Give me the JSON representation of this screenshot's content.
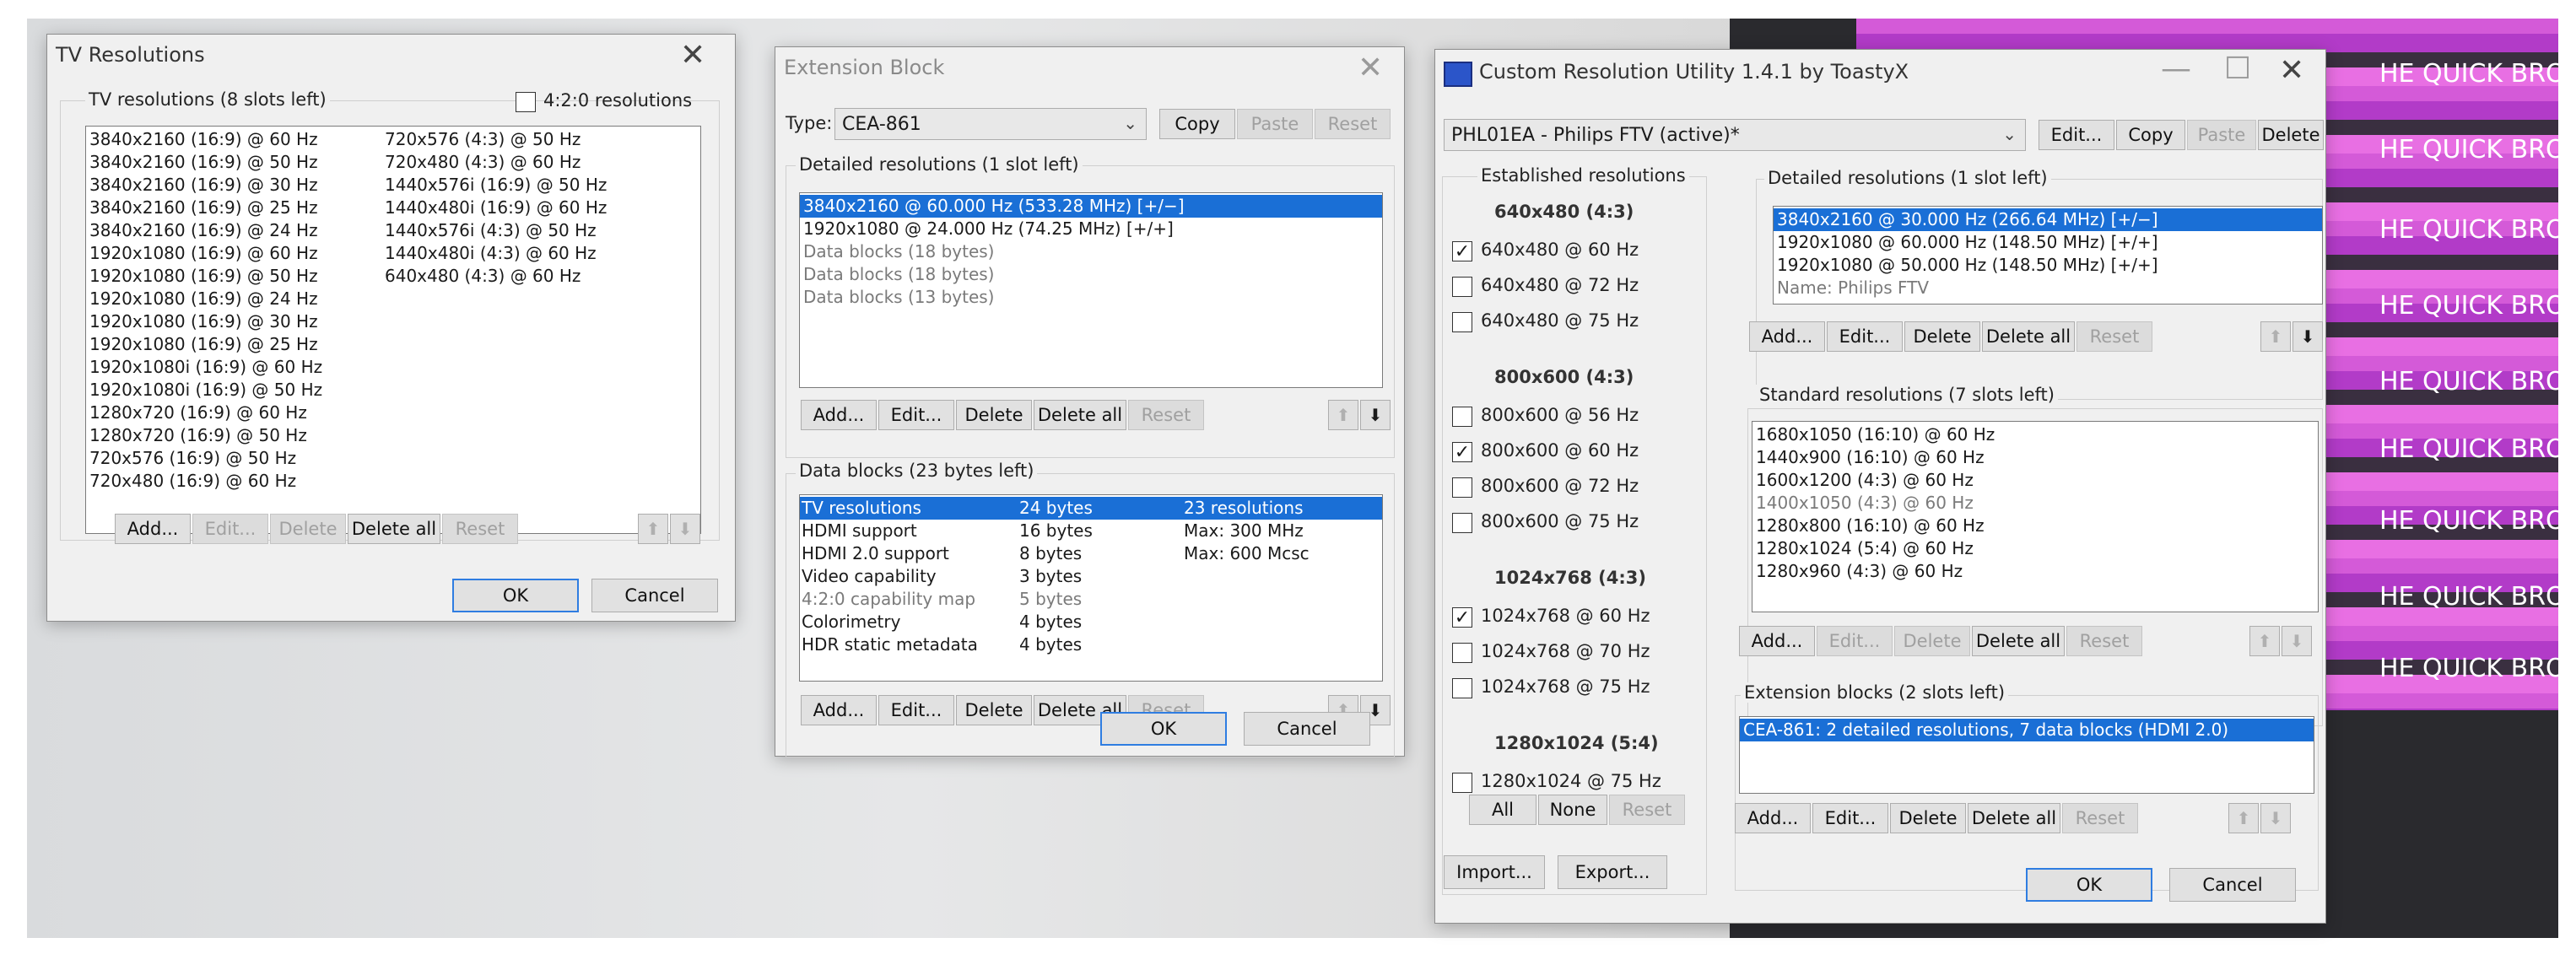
{
  "tv_dialog": {
    "title": "TV Resolutions",
    "group_label": "TV resolutions (8 slots left)",
    "option_420": "4:2:0 resolutions",
    "col1": [
      "3840x2160 (16:9) @ 60 Hz",
      "3840x2160 (16:9) @ 50 Hz",
      "3840x2160 (16:9) @ 30 Hz",
      "3840x2160 (16:9) @ 25 Hz",
      "3840x2160 (16:9) @ 24 Hz",
      "1920x1080 (16:9) @ 60 Hz",
      "1920x1080 (16:9) @ 50 Hz",
      "1920x1080 (16:9) @ 24 Hz",
      "1920x1080 (16:9) @ 30 Hz",
      "1920x1080 (16:9) @ 25 Hz",
      "1920x1080i (16:9) @ 60 Hz",
      "1920x1080i (16:9) @ 50 Hz",
      "1280x720 (16:9) @ 60 Hz",
      "1280x720 (16:9) @ 50 Hz",
      "720x576 (16:9) @ 50 Hz",
      "720x480 (16:9) @ 60 Hz"
    ],
    "col2": [
      "720x576 (4:3) @ 50 Hz",
      "720x480 (4:3) @ 60 Hz",
      "1440x576i (16:9) @ 50 Hz",
      "1440x480i (16:9) @ 60 Hz",
      "1440x576i (4:3) @ 50 Hz",
      "1440x480i (4:3) @ 60 Hz",
      "640x480 (4:3) @ 60 Hz"
    ],
    "buttons": {
      "add": "Add...",
      "edit": "Edit...",
      "delete": "Delete",
      "delete_all": "Delete all",
      "reset": "Reset",
      "ok": "OK",
      "cancel": "Cancel"
    }
  },
  "ext_dialog": {
    "title": "Extension Block",
    "type_label": "Type:",
    "type_value": "CEA-861",
    "copy": "Copy",
    "paste": "Paste",
    "reset": "Reset",
    "detailed_label": "Detailed resolutions (1 slot left)",
    "detailed": [
      "3840x2160 @ 60.000 Hz (533.28 MHz) [+/−]",
      "1920x1080 @ 24.000 Hz (74.25 MHz) [+/+]",
      "Data blocks (18 bytes)",
      "Data blocks (18 bytes)",
      "Data blocks (13 bytes)"
    ],
    "datablocks_label": "Data blocks (23 bytes left)",
    "datablocks": [
      {
        "name": "TV resolutions",
        "size": "24 bytes",
        "info": "23 resolutions"
      },
      {
        "name": "HDMI support",
        "size": "16 bytes",
        "info": "Max: 300 MHz"
      },
      {
        "name": "HDMI 2.0 support",
        "size": "8 bytes",
        "info": "Max: 600 Mcsc"
      },
      {
        "name": "Video capability",
        "size": "3 bytes",
        "info": ""
      },
      {
        "name": "4:2:0 capability map",
        "size": "5 bytes",
        "info": ""
      },
      {
        "name": "Colorimetry",
        "size": "4 bytes",
        "info": ""
      },
      {
        "name": "HDR static metadata",
        "size": "4 bytes",
        "info": ""
      }
    ],
    "buttons": {
      "add": "Add...",
      "edit": "Edit...",
      "delete": "Delete",
      "delete_all": "Delete all",
      "reset": "Reset",
      "ok": "OK",
      "cancel": "Cancel"
    }
  },
  "cru_dialog": {
    "title": "Custom Resolution Utility 1.4.1 by ToastyX",
    "monitor": "PHL01EA - Philips FTV (active)*",
    "edit": "Edit...",
    "copy": "Copy",
    "paste": "Paste",
    "delete": "Delete",
    "established_label": "Established resolutions",
    "established_groups": [
      {
        "header": "640x480 (4:3)",
        "items": [
          {
            "label": "640x480 @ 60 Hz",
            "checked": true
          },
          {
            "label": "640x480 @ 72 Hz",
            "checked": false
          },
          {
            "label": "640x480 @ 75 Hz",
            "checked": false
          }
        ]
      },
      {
        "header": "800x600 (4:3)",
        "items": [
          {
            "label": "800x600 @ 56 Hz",
            "checked": false
          },
          {
            "label": "800x600 @ 60 Hz",
            "checked": true
          },
          {
            "label": "800x600 @ 72 Hz",
            "checked": false
          },
          {
            "label": "800x600 @ 75 Hz",
            "checked": false
          }
        ]
      },
      {
        "header": "1024x768 (4:3)",
        "items": [
          {
            "label": "1024x768 @ 60 Hz",
            "checked": true
          },
          {
            "label": "1024x768 @ 70 Hz",
            "checked": false
          },
          {
            "label": "1024x768 @ 75 Hz",
            "checked": false
          }
        ]
      },
      {
        "header": "1280x1024 (5:4)",
        "items": [
          {
            "label": "1280x1024 @ 75 Hz",
            "checked": false
          }
        ]
      }
    ],
    "all": "All",
    "none": "None",
    "reset": "Reset",
    "detailed_label": "Detailed resolutions (1 slot left)",
    "detailed": [
      "3840x2160 @ 30.000 Hz (266.64 MHz) [+/−]",
      "1920x1080 @ 60.000 Hz (148.50 MHz) [+/+]",
      "1920x1080 @ 50.000 Hz (148.50 MHz) [+/+]",
      "Name: Philips FTV"
    ],
    "standard_label": "Standard resolutions (7 slots left)",
    "standard": [
      "1680x1050 (16:10) @ 60 Hz",
      "1440x900 (16:10) @ 60 Hz",
      "1600x1200 (4:3) @ 60 Hz",
      "1400x1050 (4:3) @ 60 Hz",
      "1280x800 (16:10) @ 60 Hz",
      "1280x1024 (5:4) @ 60 Hz",
      "1280x960 (4:3) @ 60 Hz"
    ],
    "extension_label": "Extension blocks (2 slots left)",
    "extension": [
      "CEA-861: 2 detailed resolutions, 7 data blocks (HDMI 2.0)"
    ],
    "buttons": {
      "add": "Add...",
      "edit": "Edit...",
      "delete": "Delete",
      "delete_all": "Delete all",
      "reset": "Reset",
      "import": "Import...",
      "export": "Export...",
      "ok": "OK",
      "cancel": "Cancel"
    }
  },
  "background_text": [
    "HE QUICK BRO",
    "HE QUICK BRO",
    "HE QUICK BRO",
    "HE QUICK BRO",
    "HE QUICK BROW",
    "HE QUICK BROW",
    "HE QUICK BROW",
    "HE QUICK BROWN",
    "HE QUICK BROWN"
  ]
}
